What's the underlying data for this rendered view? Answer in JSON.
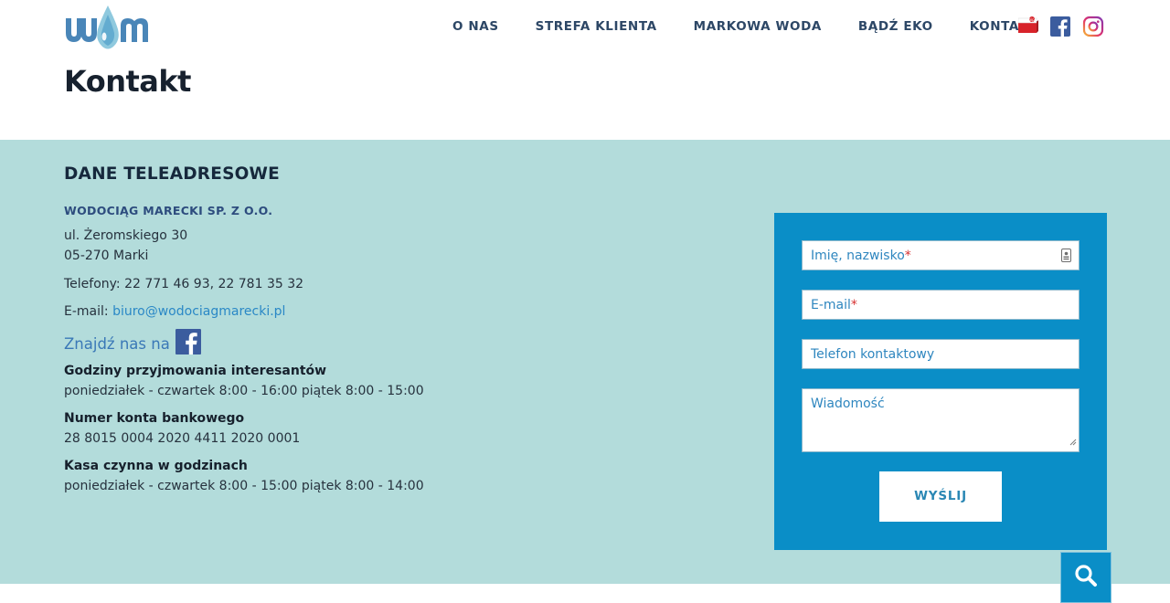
{
  "header": {
    "logo_text": "wm",
    "nav": [
      {
        "label": "O NAS"
      },
      {
        "label": "STREFA KLIENTA"
      },
      {
        "label": "MARKOWA WODA"
      },
      {
        "label": "BĄDŹ EKO"
      },
      {
        "label": "KONTAKT"
      }
    ],
    "social_icons": [
      "bip-icon",
      "facebook-icon",
      "instagram-icon"
    ],
    "bip_label": "bip"
  },
  "page": {
    "title": "Kontakt"
  },
  "contact": {
    "section_title": "DANE TELEADRESOWE",
    "company": "WODOCIĄG MARECKI SP. Z O.O.",
    "street": "ul. Żeromskiego 30",
    "city": "05-270 Marki",
    "phones": "Telefony: 22 771 46 93, 22 781 35 32",
    "email_label": "E-mail: ",
    "email": "biuro@wodociagmarecki.pl",
    "find_us": "Znajdź nas na",
    "hours_title": "Godziny przyjmowania interesantów",
    "hours": "poniedziałek - czwartek 8:00 - 16:00 piątek 8:00 - 15:00",
    "account_title": "Numer konta bankowego",
    "account": "28 8015 0004 2020 4411 2020 0001",
    "cash_title": "Kasa czynna w godzinach",
    "cash_hours": "poniedziałek - czwartek 8:00 - 15:00 piątek 8:00 - 14:00"
  },
  "form": {
    "name_placeholder": "Imię, nazwisko",
    "email_placeholder": "E-mail",
    "required_mark": "*",
    "phone_placeholder": "Telefon kontaktowy",
    "message_placeholder": "Wiadomość",
    "submit_label": "WYŚLIJ"
  },
  "colors": {
    "band": "#b3dcdb",
    "form_bg": "#0a8ec7",
    "nav_text": "#2d4766",
    "link": "#2a88c6"
  }
}
